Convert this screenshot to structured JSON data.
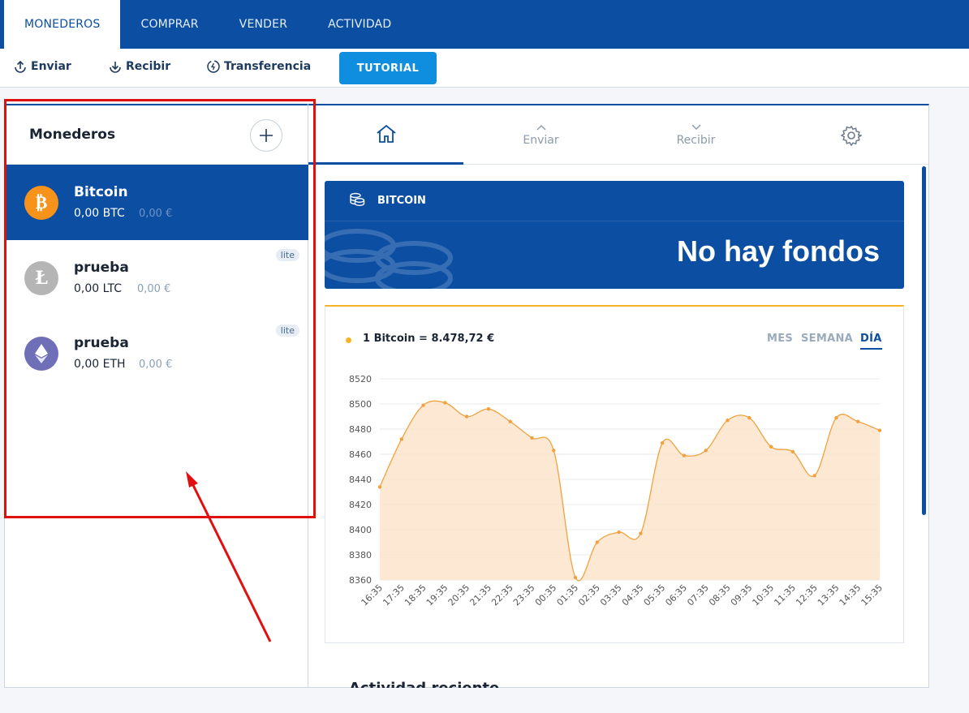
{
  "topnav": {
    "tabs": [
      {
        "label": "MONEDEROS",
        "active": true
      },
      {
        "label": "COMPRAR",
        "active": false
      },
      {
        "label": "VENDER",
        "active": false
      },
      {
        "label": "ACTIVIDAD",
        "active": false
      }
    ]
  },
  "toolbar": {
    "send_label": "Enviar",
    "receive_label": "Recibir",
    "transfer_label": "Transferencia",
    "tutorial_label": "TUTORIAL"
  },
  "wallets": {
    "title": "Monederos",
    "items": [
      {
        "name": "Bitcoin",
        "balance": "0,00 BTC",
        "fiat": "0,00 €",
        "badge": "",
        "icon": "bitcoin-icon",
        "color": "#f7931a"
      },
      {
        "name": "prueba",
        "balance": "0,00 LTC",
        "fiat": "0,00 €",
        "badge": "lite",
        "icon": "litecoin-icon",
        "color": "#b5b5b5"
      },
      {
        "name": "prueba",
        "balance": "0,00 ETH",
        "fiat": "0,00 €",
        "badge": "lite",
        "icon": "ethereum-icon",
        "color": "#6f6fb8"
      }
    ]
  },
  "detail": {
    "tabs": {
      "send": "Enviar",
      "receive": "Recibir"
    },
    "card_label": "BITCOIN",
    "card_amount": "No hay fondos",
    "rate_text": "1 Bitcoin = 8.478,72 €",
    "ranges": [
      "MES",
      "SEMANA",
      "DÍA"
    ],
    "active_range": "DÍA",
    "activity_heading": "Actividad reciente"
  },
  "colors": {
    "brand": "#0b4ea2",
    "accent": "#f5b324",
    "button": "#0f8ee0",
    "annotation": "#e01010"
  },
  "chart_data": {
    "type": "area",
    "x": [
      "16:35",
      "17:35",
      "18:35",
      "19:35",
      "20:35",
      "21:35",
      "22:35",
      "23:35",
      "00:35",
      "01:35",
      "02:35",
      "03:35",
      "04:35",
      "05:35",
      "06:35",
      "07:35",
      "08:35",
      "09:35",
      "10:35",
      "11:35",
      "12:35",
      "13:35",
      "14:35",
      "15:35"
    ],
    "values": [
      8434,
      8472,
      8499,
      8501,
      8490,
      8496,
      8486,
      8473,
      8463,
      8362,
      8390,
      8398,
      8397,
      8469,
      8459,
      8463,
      8487,
      8489,
      8466,
      8462,
      8443,
      8489,
      8486,
      8479
    ],
    "ylim": [
      8360,
      8520
    ],
    "yticks": [
      "8520",
      "8500",
      "8480",
      "8460",
      "8440",
      "8420",
      "8400",
      "8380",
      "8360"
    ],
    "grid": true
  }
}
